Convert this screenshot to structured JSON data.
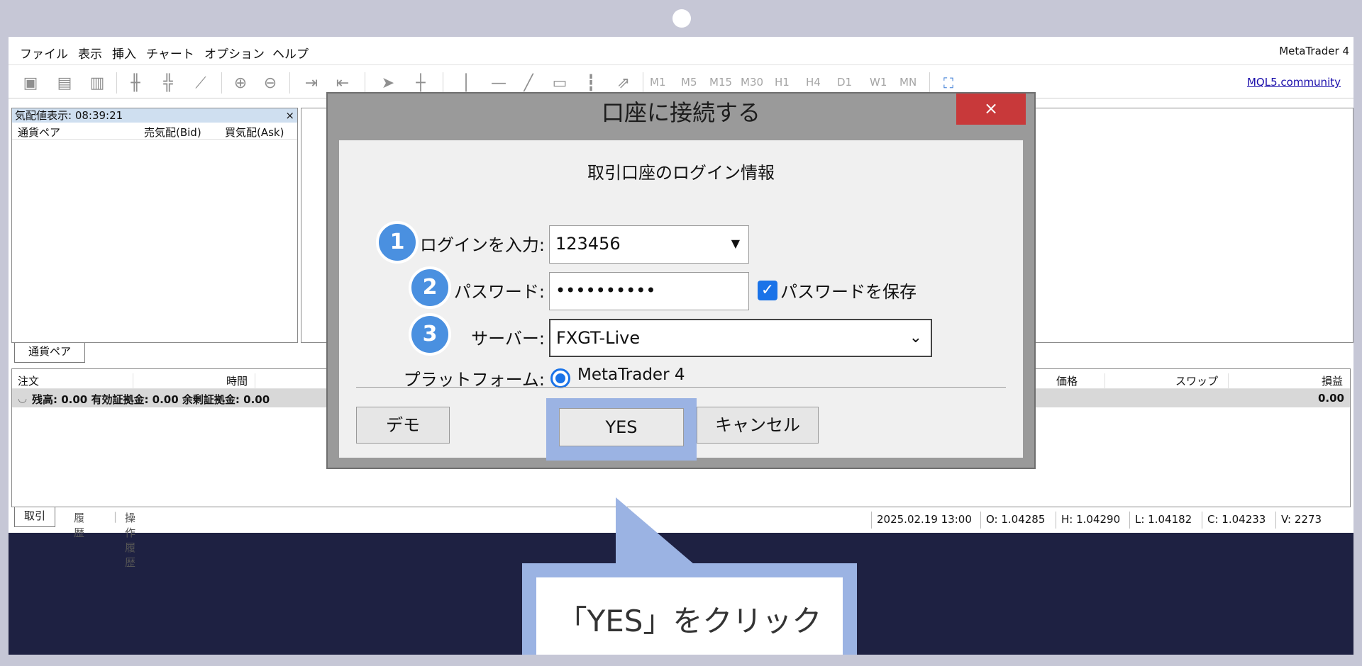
{
  "menu": [
    "ファイル",
    "表示",
    "挿入",
    "チャート",
    "オプション",
    "ヘルプ"
  ],
  "app_name": "MetaTrader 4",
  "toolbar": {
    "timeframes": [
      "M1",
      "M5",
      "M15",
      "M30",
      "H1",
      "H4",
      "D1",
      "W1",
      "MN"
    ],
    "community_link": "MQL5.community"
  },
  "market_watch": {
    "title": "気配値表示: 08:39:21",
    "close": "×",
    "columns": [
      "通貨ペア",
      "売気配(Bid)",
      "買気配(Ask)"
    ],
    "tab": "通貨ペア"
  },
  "terminal": {
    "columns": [
      "注文",
      "時間",
      "価格",
      "スワップ",
      "損益"
    ],
    "balance_row": "残高: 0.00  有効証拠金: 0.00  余剰証拠金: 0.00",
    "profit": "0.00",
    "tabs": [
      "取引",
      "履歴",
      "操作履歴"
    ]
  },
  "status_bar": [
    "2025.02.19 13:00",
    "O: 1.04285",
    "H: 1.04290",
    "L: 1.04182",
    "C: 1.04233",
    "V: 2273"
  ],
  "dialog": {
    "title": "口座に接続する",
    "close": "×",
    "heading": "取引口座のログイン情報",
    "login_label": "ログインを入力:",
    "login_value": "123456",
    "password_label": "パスワード:",
    "password_value": "••••••••••",
    "save_password_label": "パスワードを保存",
    "server_label": "サーバー:",
    "server_value": "FXGT-Live",
    "platform_label": "プラットフォーム:",
    "platform_value": "MetaTrader 4",
    "demo_button": "デモ",
    "yes_button": "YES",
    "cancel_button": "キャンセル",
    "badges": [
      "1",
      "2",
      "3"
    ]
  },
  "callout_text": "「YES」をクリック",
  "colors": {
    "accent": "#4a90e0",
    "highlight": "#9bb3e3",
    "close": "#c8393a",
    "background": "#1e2142"
  }
}
